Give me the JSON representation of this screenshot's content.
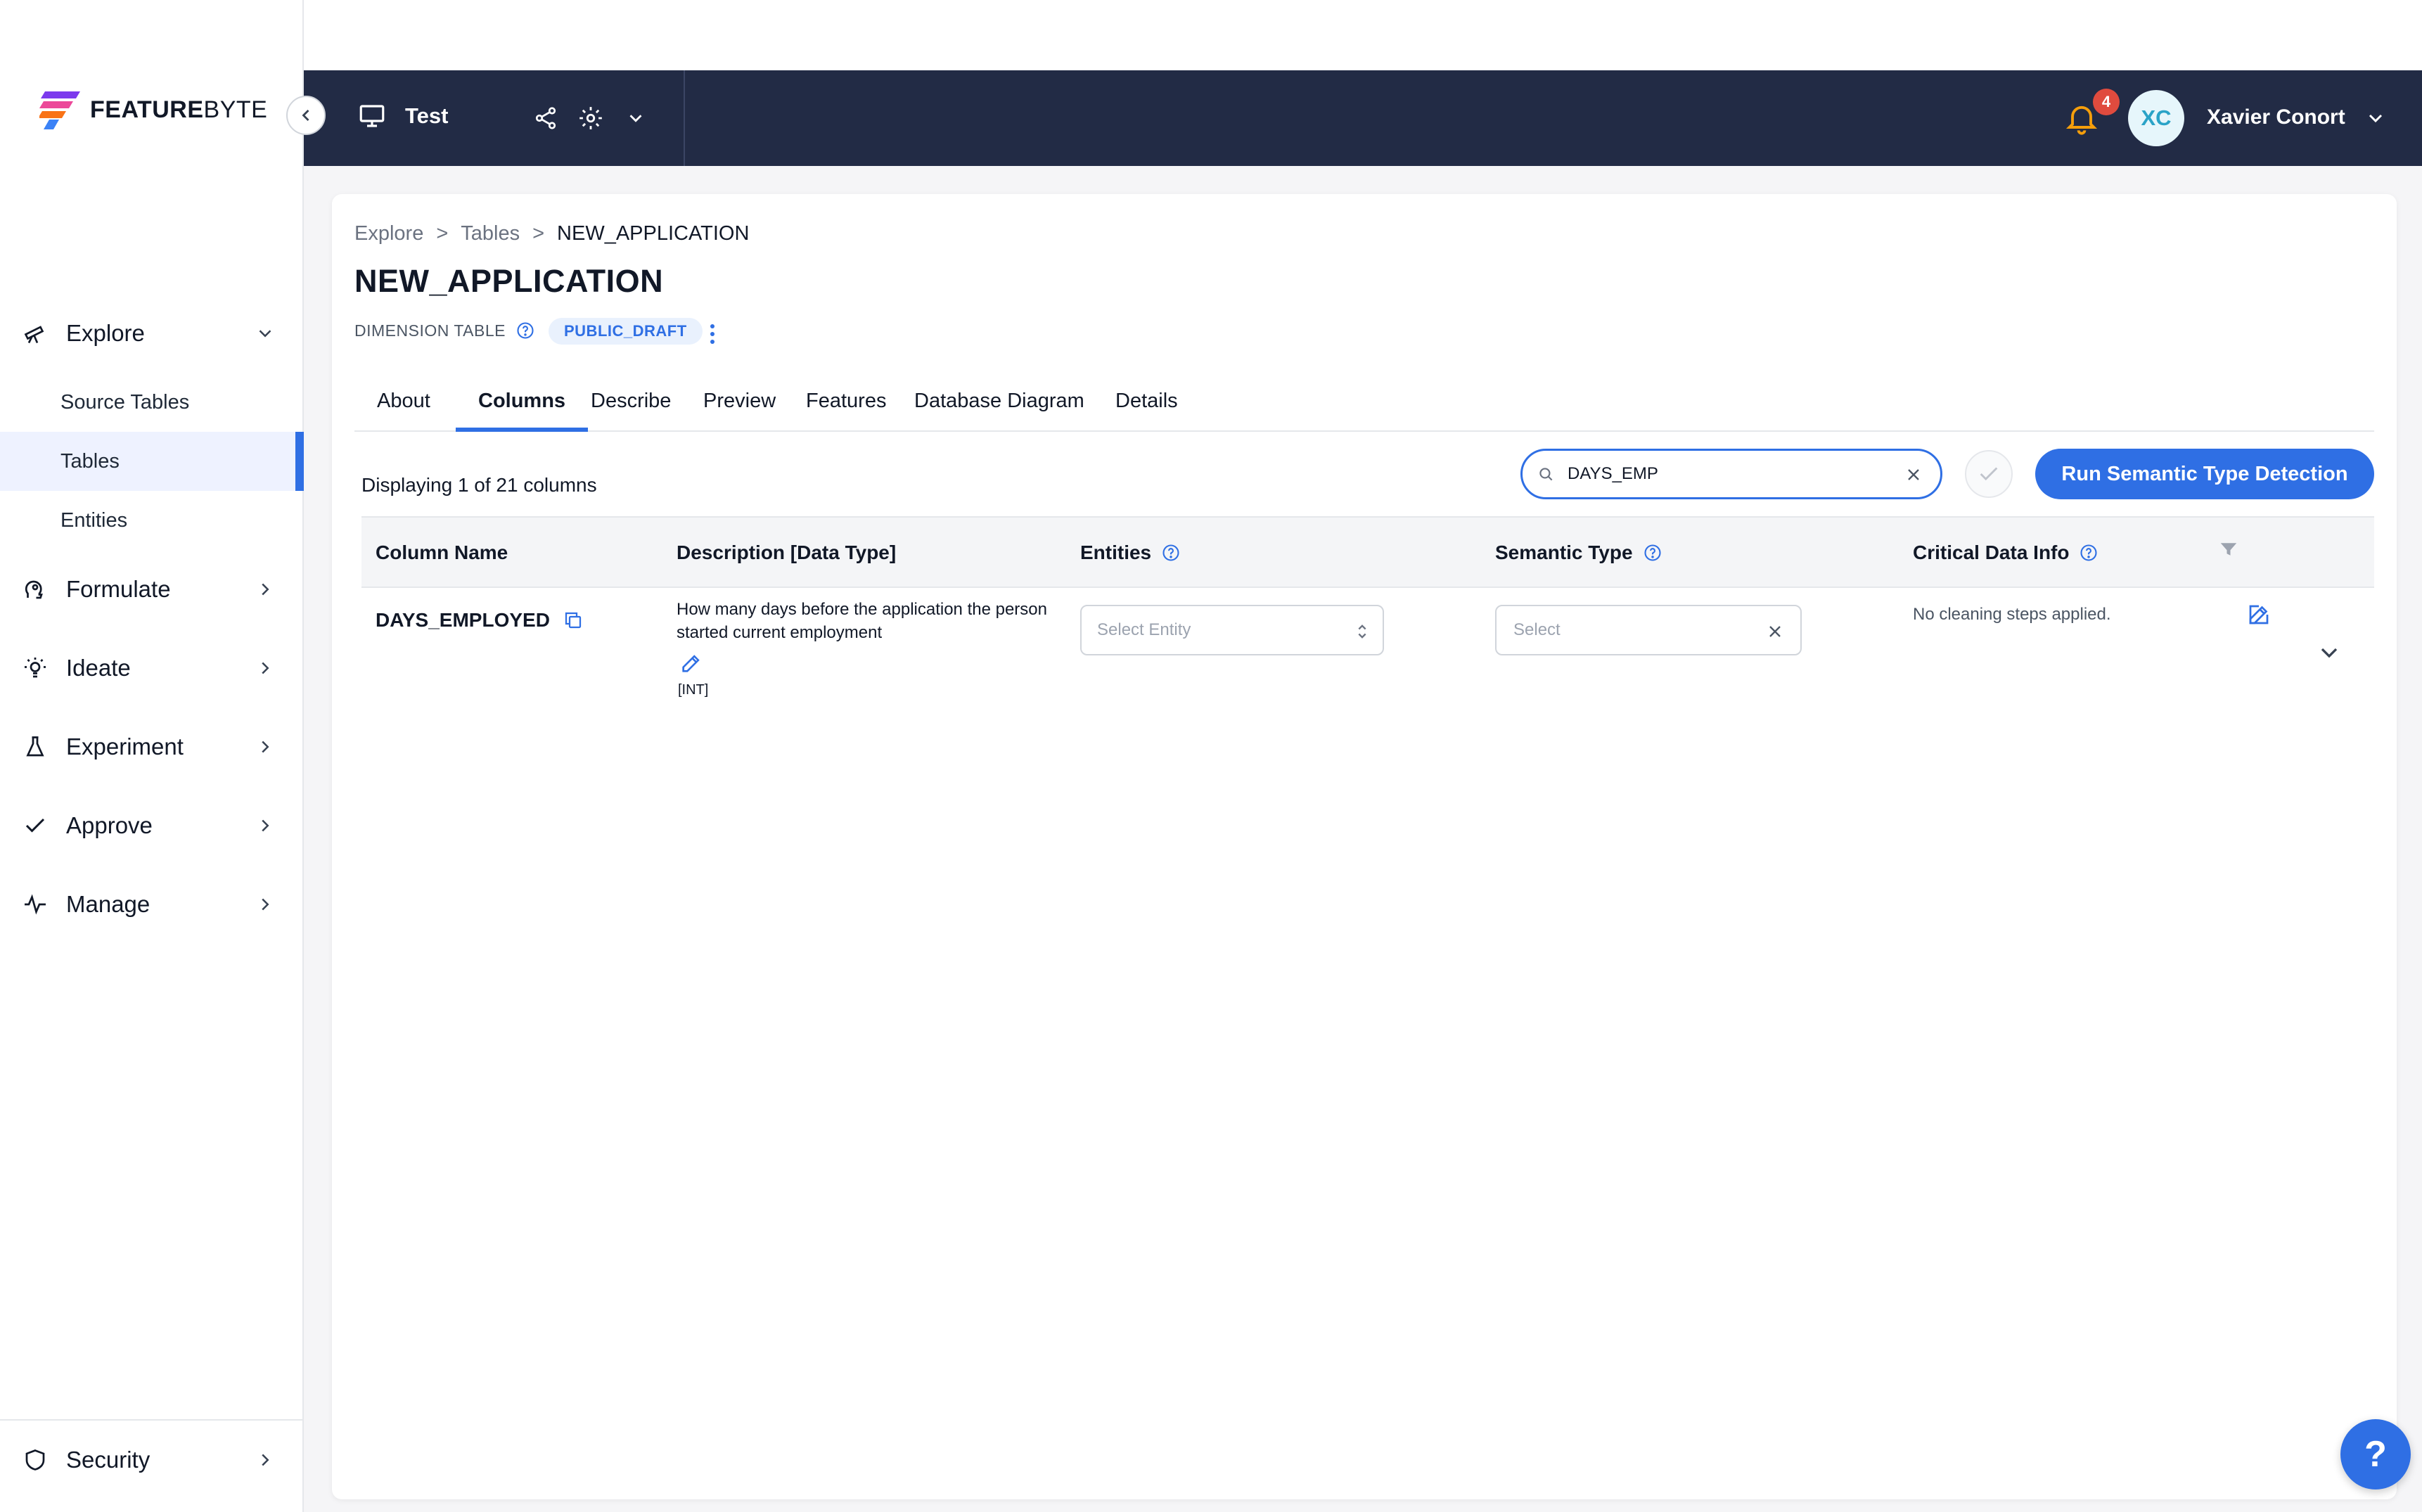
{
  "brand": {
    "name_bold": "FEATURE",
    "name_light": "BYTE"
  },
  "sidebar": {
    "items": [
      {
        "label": "Explore",
        "icon": "telescope-icon",
        "expanded": true
      },
      {
        "label": "Formulate",
        "icon": "head-icon"
      },
      {
        "label": "Ideate",
        "icon": "lightbulb-icon"
      },
      {
        "label": "Experiment",
        "icon": "flask-icon"
      },
      {
        "label": "Approve",
        "icon": "check-icon"
      },
      {
        "label": "Manage",
        "icon": "activity-icon"
      }
    ],
    "explore_sub": [
      "Source Tables",
      "Tables",
      "Entities"
    ],
    "active_sub": "Tables",
    "security_label": "Security"
  },
  "topbar": {
    "workspace": "Test",
    "notification_count": "4",
    "avatar_initials": "XC",
    "user_name": "Xavier Conort"
  },
  "breadcrumb": [
    "Explore",
    "Tables",
    "NEW_APPLICATION"
  ],
  "breadcrumb_sep": ">",
  "page": {
    "title": "NEW_APPLICATION",
    "table_type": "DIMENSION TABLE",
    "status": "PUBLIC_DRAFT"
  },
  "tabs": [
    "About",
    "Columns",
    "Describe",
    "Preview",
    "Features",
    "Database Diagram",
    "Details"
  ],
  "active_tab": "Columns",
  "toolbar": {
    "display_count": "Displaying 1 of 21 columns",
    "search_value": "DAYS_EMP",
    "run_button": "Run Semantic Type Detection"
  },
  "table": {
    "headers": {
      "column_name": "Column Name",
      "description": "Description [Data Type]",
      "entities": "Entities",
      "semantic_type": "Semantic Type",
      "critical": "Critical Data Info"
    },
    "rows": [
      {
        "column_name": "DAYS_EMPLOYED",
        "description": "How many days before the application the person started current employment",
        "data_type": "[INT]",
        "entity_placeholder": "Select Entity",
        "semantic_placeholder": "Select",
        "critical": "No cleaning steps applied."
      }
    ]
  },
  "help_fab": "?",
  "colors": {
    "primary": "#2f6fe4",
    "topbar": "#222b45",
    "badge": "#e04b3e",
    "bell": "#f59e0b"
  }
}
